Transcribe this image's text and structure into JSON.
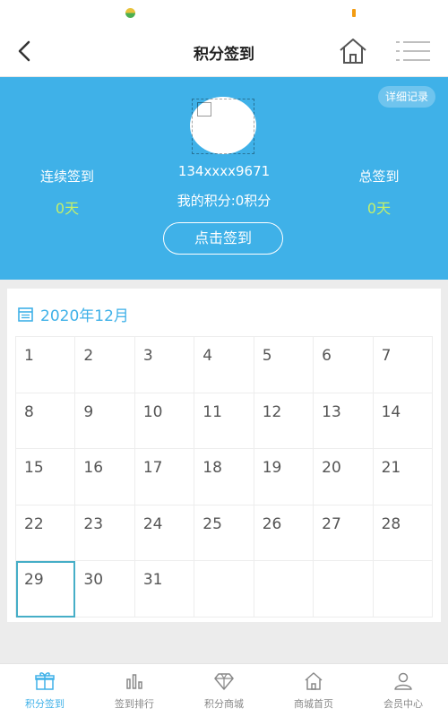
{
  "nav": {
    "title": "积分签到"
  },
  "hero": {
    "detail_label": "详细记录",
    "phone": "134xxxx9671",
    "points_text": "我的积分:0积分",
    "streak_label": "连续签到",
    "streak_value": "0天",
    "total_label": "总签到",
    "total_value": "0天",
    "sign_button": "点击签到",
    "accent_color": "#3fb1e8"
  },
  "calendar": {
    "month_label": "2020年12月",
    "days": [
      "1",
      "2",
      "3",
      "4",
      "5",
      "6",
      "7",
      "8",
      "9",
      "10",
      "11",
      "12",
      "13",
      "14",
      "15",
      "16",
      "17",
      "18",
      "19",
      "20",
      "21",
      "22",
      "23",
      "24",
      "25",
      "26",
      "27",
      "28",
      "29",
      "30",
      "31"
    ],
    "selected_day": "29"
  },
  "tabs": [
    {
      "label": "积分签到",
      "icon": "gift-icon",
      "active": true
    },
    {
      "label": "签到排行",
      "icon": "bar-chart-icon",
      "active": false
    },
    {
      "label": "积分商城",
      "icon": "diamond-icon",
      "active": false
    },
    {
      "label": "商城首页",
      "icon": "home-icon",
      "active": false
    },
    {
      "label": "会员中心",
      "icon": "user-icon",
      "active": false
    }
  ]
}
